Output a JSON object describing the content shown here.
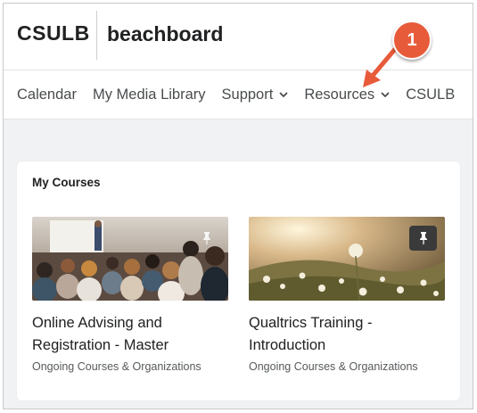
{
  "header": {
    "logo_left": "CSULB",
    "logo_right": "beachboard"
  },
  "nav": {
    "items": [
      {
        "label": "Calendar",
        "dropdown": false
      },
      {
        "label": "My Media Library",
        "dropdown": false
      },
      {
        "label": "Support",
        "dropdown": true
      },
      {
        "label": "Resources",
        "dropdown": true
      },
      {
        "label": "CSULB",
        "dropdown": false
      }
    ]
  },
  "widget": {
    "title": "My Courses",
    "courses": [
      {
        "title_line1": "Online Advising and",
        "title_line2": "Registration - Master",
        "subtitle": "Ongoing Courses & Organizations",
        "image": "lecture-audience-photo",
        "pinned": true
      },
      {
        "title_line1": "Qualtrics Training -",
        "title_line2": "Introduction",
        "subtitle": "Ongoing Courses & Organizations",
        "image": "dandelion-meadow-photo",
        "pinned": true
      }
    ]
  },
  "annotation": {
    "badge_number": "1",
    "color": "#e85b3a"
  }
}
